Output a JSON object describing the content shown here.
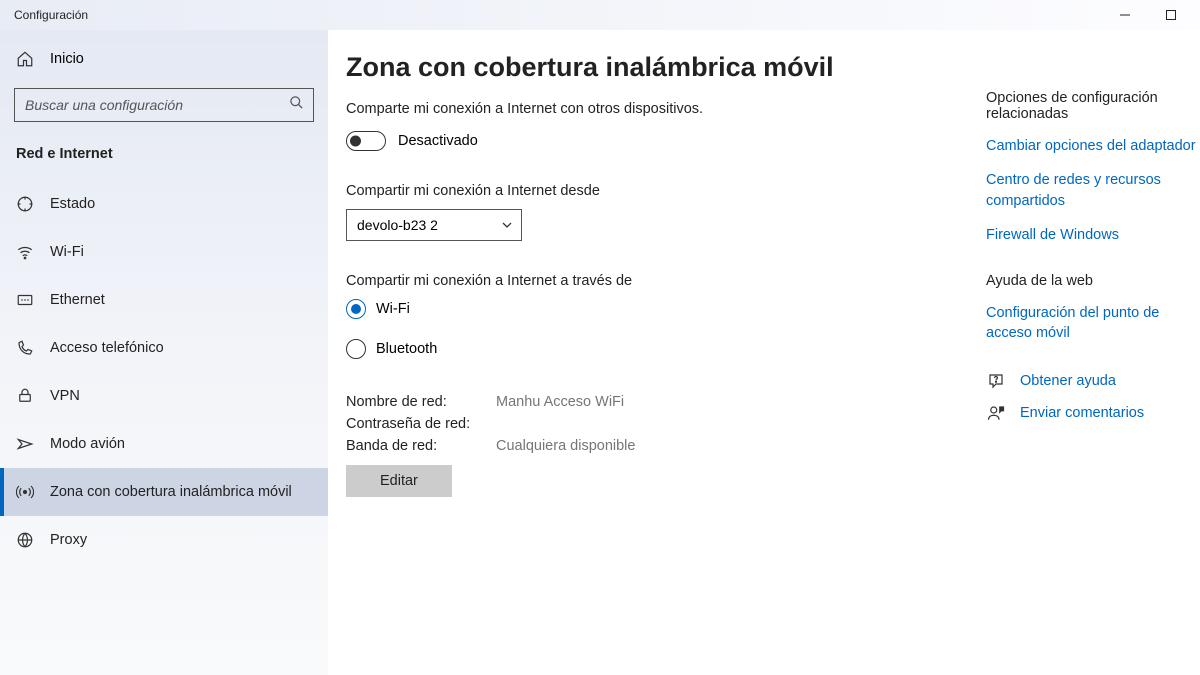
{
  "window": {
    "title": "Configuración"
  },
  "sidebar": {
    "home": "Inicio",
    "search_placeholder": "Buscar una configuración",
    "category": "Red e Internet",
    "items": [
      {
        "id": "status",
        "label": "Estado"
      },
      {
        "id": "wifi",
        "label": "Wi-Fi"
      },
      {
        "id": "ethernet",
        "label": "Ethernet"
      },
      {
        "id": "dialup",
        "label": "Acceso telefónico"
      },
      {
        "id": "vpn",
        "label": "VPN"
      },
      {
        "id": "airplane",
        "label": "Modo avión"
      },
      {
        "id": "hotspot",
        "label": "Zona con cobertura inalámbrica móvil"
      },
      {
        "id": "proxy",
        "label": "Proxy"
      }
    ]
  },
  "main": {
    "title": "Zona con cobertura inalámbrica móvil",
    "share_desc": "Comparte mi conexión a Internet con otros dispositivos.",
    "toggle_state": "Desactivado",
    "share_from_label": "Compartir mi conexión a Internet desde",
    "share_from_value": "devolo-b23 2",
    "share_over_label": "Compartir mi conexión a Internet a través de",
    "radio_wifi": "Wi-Fi",
    "radio_bluetooth": "Bluetooth",
    "info": {
      "name_label": "Nombre de red:",
      "name_value": "Manhu Acceso WiFi",
      "password_label": "Contraseña de red:",
      "password_value": "",
      "band_label": "Banda de red:",
      "band_value": "Cualquiera disponible"
    },
    "edit_label": "Editar"
  },
  "right": {
    "related_heading": "Opciones de configuración relacionadas",
    "link_adapter": "Cambiar opciones del adaptador",
    "link_sharing": "Centro de redes y recursos compartidos",
    "link_firewall": "Firewall de Windows",
    "web_help_heading": "Ayuda de la web",
    "link_hotspot_config": "Configuración del punto de acceso móvil",
    "get_help": "Obtener ayuda",
    "feedback": "Enviar comentarios"
  }
}
